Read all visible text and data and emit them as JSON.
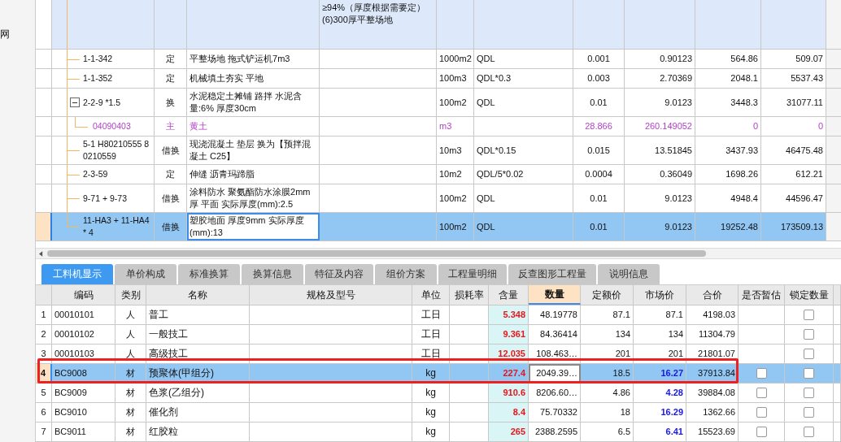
{
  "left_panel": {
    "label": "网"
  },
  "quota_table": {
    "parent_row": {
      "feature_lines": [
        "≥94%（厚度根据需要定）",
        "(6)300厚平整场地"
      ]
    },
    "rows": [
      {
        "code": "1-1-342",
        "type": "定",
        "name": "平整场地 拖式铲运机7m3",
        "unit": "1000m2",
        "expression": "QDL",
        "content": "0.001",
        "quantity": "0.90123",
        "unit_price": "564.86",
        "total": "509.07",
        "kind": "quota",
        "selected": false
      },
      {
        "code": "1-1-352",
        "type": "定",
        "name": "机械填土夯实 平地",
        "unit": "100m3",
        "expression": "QDL*0.3",
        "content": "0.003",
        "quantity": "2.70369",
        "unit_price": "2048.1",
        "total": "5537.43",
        "kind": "quota",
        "selected": false
      },
      {
        "code": "2-2-9 *1.5",
        "type": "换",
        "name": "水泥稳定土摊铺 路拌 水泥含量:6% 厚度30cm",
        "unit": "100m2",
        "expression": "QDL",
        "content": "0.01",
        "quantity": "9.0123",
        "unit_price": "3448.3",
        "total": "31077.11",
        "kind": "quota",
        "selected": false,
        "expanded": true,
        "children": [
          {
            "code": "04090403",
            "type": "主",
            "name": "黄土",
            "unit": "m3",
            "content": "28.866",
            "quantity": "260.149052",
            "unit_price": "0",
            "total": "0",
            "kind": "main",
            "selected": false
          }
        ]
      },
      {
        "code": "5-1 H80210555 80210559",
        "type": "借换",
        "name": "现浇混凝土 垫层  换为【预拌混凝土 C25】",
        "unit": "10m3",
        "expression": "QDL*0.15",
        "content": "0.015",
        "quantity": "13.51845",
        "unit_price": "3437.93",
        "total": "46475.48",
        "kind": "quota",
        "selected": false
      },
      {
        "code": "2-3-59",
        "type": "定",
        "name": "伸缝 沥青玛蹄脂",
        "unit": "10m2",
        "expression": "QDL/5*0.02",
        "content": "0.0004",
        "quantity": "0.36049",
        "unit_price": "1698.26",
        "total": "612.21",
        "kind": "quota",
        "selected": false
      },
      {
        "code": "9-71 + 9-73",
        "type": "借换",
        "name": "涂料防水 聚氨酯防水涂膜2mm厚 平面  实际厚度(mm):2.5",
        "unit": "100m2",
        "expression": "QDL",
        "content": "0.01",
        "quantity": "9.0123",
        "unit_price": "4948.4",
        "total": "44596.47",
        "kind": "quota",
        "selected": false
      },
      {
        "code": "11-HA3 + 11-HA4 * 4",
        "type": "借换",
        "name": "塑胶地面 厚度9mm  实际厚度(mm):13",
        "unit": "100m2",
        "expression": "QDL",
        "content": "0.01",
        "quantity": "9.0123",
        "unit_price": "19252.48",
        "total": "173509.13",
        "kind": "quota",
        "selected": true
      }
    ]
  },
  "tabs": [
    {
      "label": "工料机显示",
      "selected": true
    },
    {
      "label": "单价构成",
      "selected": false
    },
    {
      "label": "标准换算",
      "selected": false
    },
    {
      "label": "换算信息",
      "selected": false
    },
    {
      "label": "特征及内容",
      "selected": false
    },
    {
      "label": "组价方案",
      "selected": false
    },
    {
      "label": "工程量明细",
      "selected": false
    },
    {
      "label": "反查图形工程量",
      "selected": false
    },
    {
      "label": "说明信息",
      "selected": false
    }
  ],
  "resource_table": {
    "columns": [
      "编码",
      "类别",
      "名称",
      "规格及型号",
      "单位",
      "损耗率",
      "含量",
      "数量",
      "定额价",
      "市场价",
      "合价",
      "是否暂估",
      "锁定数量"
    ],
    "rows": [
      {
        "no": "1",
        "code": "00010101",
        "type": "人",
        "name": "普工",
        "unit": "工日",
        "content": "5.348",
        "quantity": "48.19778",
        "base_price": "87.1",
        "market_price": "87.1",
        "market_changed": false,
        "total": "4198.03",
        "locked": false,
        "selected": false
      },
      {
        "no": "2",
        "code": "00010102",
        "type": "人",
        "name": "一般技工",
        "unit": "工日",
        "content": "9.361",
        "quantity": "84.36414",
        "base_price": "134",
        "market_price": "134",
        "market_changed": false,
        "total": "11304.79",
        "locked": false,
        "selected": false
      },
      {
        "no": "3",
        "code": "00010103",
        "type": "人",
        "name": "高级技工",
        "unit": "工日",
        "content": "12.035",
        "quantity": "108.463…",
        "base_price": "201",
        "market_price": "201",
        "market_changed": false,
        "total": "21801.07",
        "locked": false,
        "selected": false
      },
      {
        "no": "4",
        "code": "BC9008",
        "type": "材",
        "name": "预聚体(甲组分)",
        "unit": "kg",
        "content": "227.4",
        "quantity": "2049.39…",
        "base_price": "18.5",
        "market_price": "16.27",
        "market_changed": true,
        "total": "37913.84",
        "provisional": false,
        "locked": false,
        "selected": true
      },
      {
        "no": "5",
        "code": "BC9009",
        "type": "材",
        "name": "色浆(乙组分)",
        "unit": "kg",
        "content": "910.6",
        "quantity": "8206.60…",
        "base_price": "4.86",
        "market_price": "4.28",
        "market_changed": true,
        "total": "39884.08",
        "provisional": false,
        "locked": false,
        "selected": false
      },
      {
        "no": "6",
        "code": "BC9010",
        "type": "材",
        "name": "催化剂",
        "unit": "kg",
        "content": "8.4",
        "quantity": "75.70332",
        "base_price": "18",
        "market_price": "16.29",
        "market_changed": true,
        "total": "1362.66",
        "provisional": false,
        "locked": false,
        "selected": false
      },
      {
        "no": "7",
        "code": "BC9011",
        "type": "材",
        "name": "红胶粒",
        "unit": "kg",
        "content": "265",
        "quantity": "2388.2595",
        "base_price": "6.5",
        "market_price": "6.41",
        "market_changed": true,
        "total": "15523.69",
        "provisional": false,
        "locked": false,
        "selected": false
      }
    ]
  }
}
